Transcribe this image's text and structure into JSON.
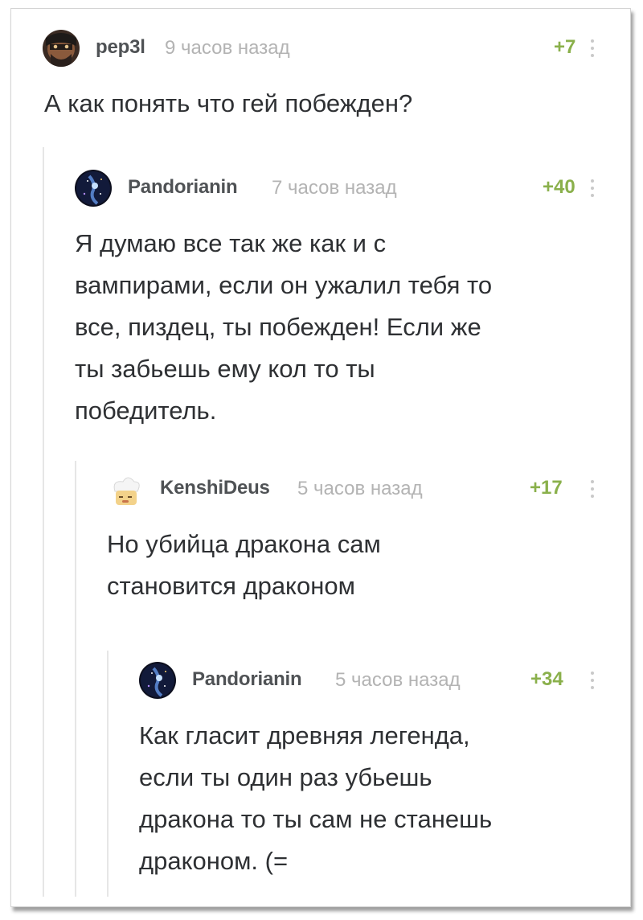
{
  "comments": [
    {
      "author": "pep3l",
      "time": "9 часов назад",
      "rating": "+7",
      "avatar_icon": "masked-face-avatar",
      "text": "А как понять что гей побежден?"
    },
    {
      "author": "Pandorianin",
      "time": "7 часов назад",
      "rating": "+40",
      "avatar_icon": "galaxy-avatar",
      "text": "Я думаю все так же как и с\nвампирами, если он ужалил тебя то\nвсе, пиздец, ты побежден! Если же\nты забьешь ему кол то ты\nпобедитель."
    },
    {
      "author": "KenshiDeus",
      "time": "5 часов назад",
      "rating": "+17",
      "avatar_icon": "sleepy-chef-avatar",
      "text": "Но убийца дракона сам\nстановится драконом"
    },
    {
      "author": "Pandorianin",
      "time": "5 часов назад",
      "rating": "+34",
      "avatar_icon": "galaxy-avatar",
      "text": "Как гласит древняя легенда,\nесли ты один раз убьешь\nдракона то ты сам не станешь\nдраконом. (="
    }
  ],
  "colors": {
    "author": "#4f5255",
    "time": "#b3b3b3",
    "rating": "#8ab04b",
    "text": "#2e3033",
    "branch_line": "#e6e6e6"
  }
}
